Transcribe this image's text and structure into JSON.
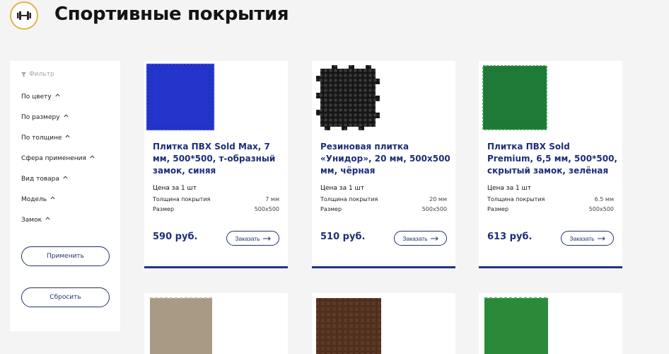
{
  "header": {
    "title": "Спортивные покрытия",
    "logo_icon": "dumbbell-icon"
  },
  "filter": {
    "heading": "Фильтр",
    "items": [
      "По цвету",
      "По размеру",
      "По толщине",
      "Сфера применения",
      "Вид товара",
      "Модель",
      "Замок"
    ],
    "apply_label": "Применить",
    "reset_label": "Сбросить"
  },
  "products": [
    {
      "name": "Плитка ПВХ Sold Max, 7 мм, 500*500, т-образный замок, синяя",
      "price_unit": "Цена за 1 шт",
      "thickness_label": "Толщина покрытия",
      "thickness": "7 мм",
      "size_label": "Размер",
      "size": "500х500",
      "price": "590 руб.",
      "order_label": "Заказать",
      "color": "#2233c8"
    },
    {
      "name": "Резиновая плитка «Унидор», 20 мм, 500х500 мм, чёрная",
      "price_unit": "Цена за 1 шт",
      "thickness_label": "Толщина покрытия",
      "thickness": "20 мм",
      "size_label": "Размер",
      "size": "500х500",
      "price": "510 руб.",
      "order_label": "Заказать",
      "color": "#1c1c1c"
    },
    {
      "name": "Плитка ПВХ Sold Premium, 6,5 мм, 500*500, скрытый замок, зелёная",
      "price_unit": "Цена за 1 шт",
      "thickness_label": "Толщина покрытия",
      "thickness": "6.5 мм",
      "size_label": "Размер",
      "size": "500х500",
      "price": "613 руб.",
      "order_label": "Заказать",
      "color": "#1e7a36"
    }
  ],
  "more_products": [
    {
      "color": "#a89a84"
    },
    {
      "color": "#4f2f1f"
    },
    {
      "color": "#2a8a3a"
    }
  ],
  "colors": {
    "accent": "#1e2e78",
    "logo_ring": "#e1b24a"
  }
}
